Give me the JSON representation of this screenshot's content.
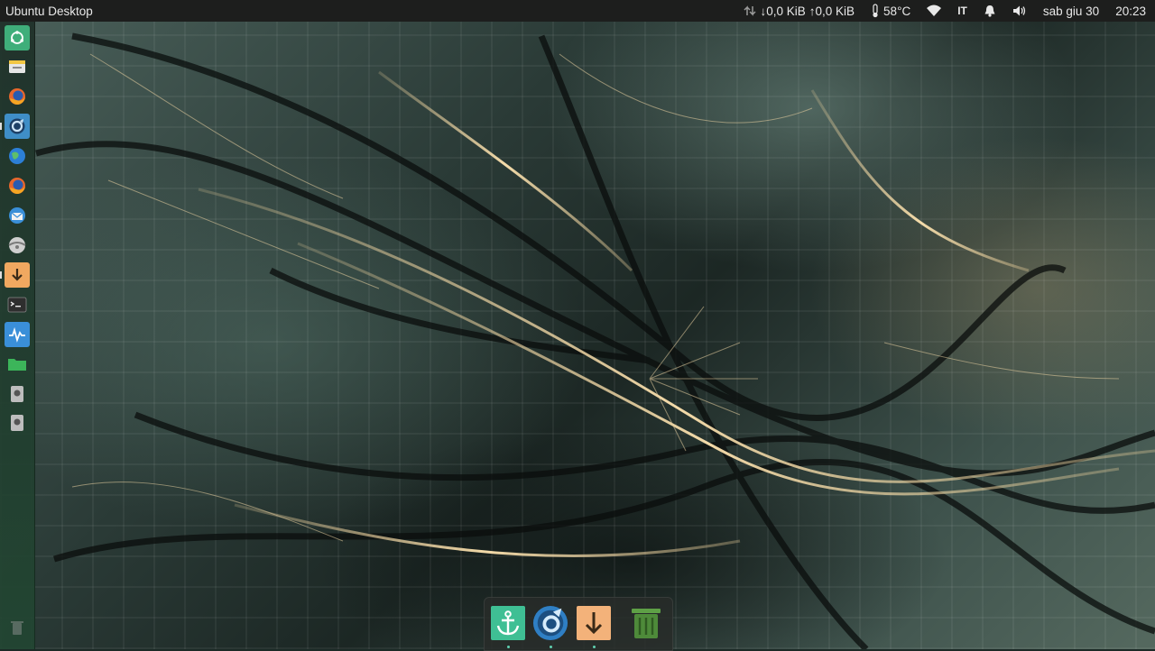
{
  "topbar": {
    "title": "Ubuntu Desktop",
    "net_down": "↓0,0 KiB",
    "net_up": "↑0,0 KiB",
    "temperature": "58°C",
    "keyboard_layout": "IT",
    "date": "sab giu 30",
    "time": "20:23"
  },
  "launcher": {
    "items": [
      {
        "icon": "ubuntu-home-icon",
        "color": "#3fae7a"
      },
      {
        "icon": "files-icon",
        "color": "#e6e6e6"
      },
      {
        "icon": "firefox-icon",
        "color": "#e8672c"
      },
      {
        "icon": "browser-active-icon",
        "color": "#2b6fa8"
      },
      {
        "icon": "globe-icon",
        "color": "#2c7fd6"
      },
      {
        "icon": "firefox-alt-icon",
        "color": "#e8672c"
      },
      {
        "icon": "thunderbird-icon",
        "color": "#3a8fd8"
      },
      {
        "icon": "disk-icon",
        "color": "#cfcfcf"
      },
      {
        "icon": "download-icon",
        "color": "#f0a860"
      },
      {
        "icon": "terminal-icon",
        "color": "#2e2e2e"
      },
      {
        "icon": "system-monitor-icon",
        "color": "#3a8fd8"
      },
      {
        "icon": "folder-icon",
        "color": "#3cb55a"
      },
      {
        "icon": "drive-icon",
        "color": "#bdbdbd"
      },
      {
        "icon": "drive-alt-icon",
        "color": "#bdbdbd"
      }
    ],
    "trash_icon": "trash-icon"
  },
  "dock": {
    "items": [
      {
        "icon": "anchor-icon",
        "color": "#3fbf94"
      },
      {
        "icon": "refresh-circle-icon",
        "color": "#2f7fc4"
      },
      {
        "icon": "download-arrow-icon",
        "color": "#f3b27a"
      },
      {
        "icon": "trash-bin-icon",
        "color": "#4e8a3a"
      }
    ]
  }
}
